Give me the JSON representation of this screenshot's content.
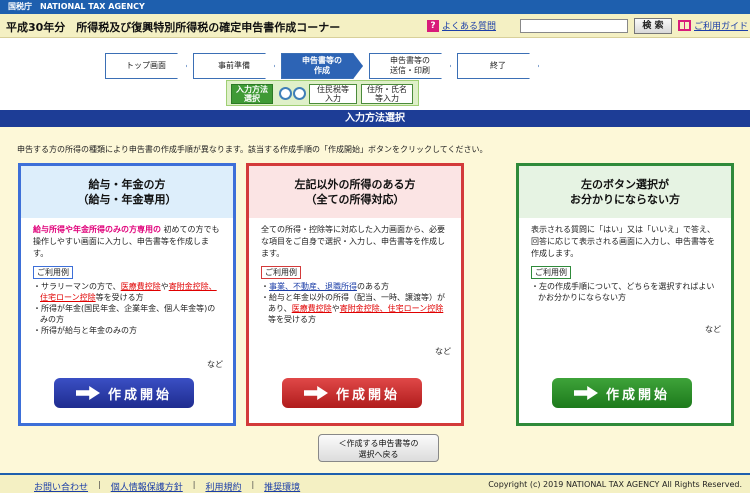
{
  "header": {
    "agency": "国税庁　NATIONAL TAX AGENCY",
    "title": "平成30年分　所得税及び復興特別所得税の確定申告書作成コーナー",
    "faq_icon": "?",
    "faq_label": "よくある質問",
    "search_placeholder": "",
    "search_button": "検 索",
    "guide_label": "ご利用ガイド"
  },
  "steps": [
    {
      "label": "トップ画面",
      "active": false
    },
    {
      "label": "事前準備",
      "active": false
    },
    {
      "label": "申告書等の\n作成",
      "active": true
    },
    {
      "label": "申告書等の\n送信・印刷",
      "active": false
    },
    {
      "label": "終了",
      "active": false
    }
  ],
  "substeps": [
    {
      "label": "入力方法\n選択",
      "active": true
    },
    {
      "label": "住民税等\n入力",
      "active": false
    },
    {
      "label": "住所・氏名\n等入力",
      "active": false
    }
  ],
  "section_title": "入力方法選択",
  "intro": "申告する方の所得の種類により申告書の作成手順が異なります。該当する作成手順の「作成開始」ボタンをクリックしてください。",
  "panels": [
    {
      "title1": "給与・年金の方",
      "title2": "（給与・年金専用）",
      "highlight": "給与所得や年金所得のみの方専用の",
      "desc": "初めての方でも操作しやすい画面に入力し、申告書等を作成します。",
      "tag": "ご利用例",
      "items": [
        [
          "・サラリーマンの方で、",
          "医療費控除",
          "や",
          "寄附金控除、住宅ローン控除",
          "等を受ける方"
        ],
        [
          "・所得が年金(国民年金、企業年金、個人年金等)のみの方"
        ],
        [
          "・所得が給与と年金のみの方"
        ]
      ],
      "etc": "など",
      "button": "作成開始"
    },
    {
      "title1": "左記以外の所得のある方",
      "title2": "（全ての所得対応）",
      "desc": "全ての所得・控除等に対応した入力画面から、必要な項目をご自身で選択・入力し、申告書等を作成します。",
      "tag": "ご利用例",
      "items": [
        [
          "・",
          "事業、不動産、退職所得",
          "のある方"
        ],
        [
          "・給与と年金以外の所得（配当、一時、譲渡等）があり、",
          "医療費控除",
          "や",
          "寄附金控除、住宅ローン控除",
          "等を受ける方"
        ]
      ],
      "etc": "など",
      "button": "作成開始"
    },
    {
      "title1": "左のボタン選択が",
      "title2": "お分かりにならない方",
      "desc": "表示される質問に「はい」又は「いいえ」で答え、回答に応じて表示される画面に入力し、申告書等を作成します。",
      "tag": "ご利用例",
      "items": [
        [
          "・左の作成手順について、どちらを選択すればよいかお分かりにならない方"
        ]
      ],
      "etc": "など",
      "button": "作成開始"
    }
  ],
  "back_button": "＜作成する申告書等の\n選択へ戻る",
  "footer": {
    "links": [
      "お問い合わせ",
      "個人情報保護方針",
      "利用規約",
      "推奨環境"
    ],
    "copyright": "Copyright (c) 2019 NATIONAL TAX AGENCY All Rights Reserved."
  }
}
